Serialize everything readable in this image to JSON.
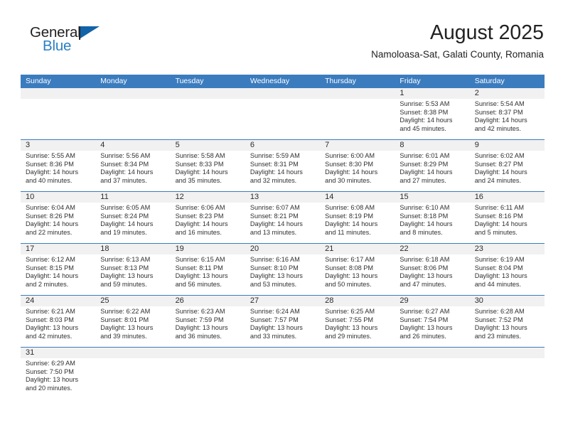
{
  "brand": {
    "name_top": "General",
    "name_bottom": "Blue",
    "flag_icon": "triangular-flag-icon",
    "color_top": "#231f20",
    "color_bottom": "#2b7fc4",
    "flag_color": "#1263a8"
  },
  "header": {
    "title": "August 2025",
    "subtitle": "Namoloasa-Sat, Galati County, Romania"
  },
  "colors": {
    "header_blue": "#3b7cbf",
    "numbar_gray": "#f1f1f1",
    "text": "#303030"
  },
  "weekdays": [
    "Sunday",
    "Monday",
    "Tuesday",
    "Wednesday",
    "Thursday",
    "Friday",
    "Saturday"
  ],
  "weeks": [
    [
      {
        "day": "",
        "lines": []
      },
      {
        "day": "",
        "lines": []
      },
      {
        "day": "",
        "lines": []
      },
      {
        "day": "",
        "lines": []
      },
      {
        "day": "",
        "lines": []
      },
      {
        "day": "1",
        "lines": [
          "Sunrise: 5:53 AM",
          "Sunset: 8:38 PM",
          "Daylight: 14 hours",
          "and 45 minutes."
        ]
      },
      {
        "day": "2",
        "lines": [
          "Sunrise: 5:54 AM",
          "Sunset: 8:37 PM",
          "Daylight: 14 hours",
          "and 42 minutes."
        ]
      }
    ],
    [
      {
        "day": "3",
        "lines": [
          "Sunrise: 5:55 AM",
          "Sunset: 8:36 PM",
          "Daylight: 14 hours",
          "and 40 minutes."
        ]
      },
      {
        "day": "4",
        "lines": [
          "Sunrise: 5:56 AM",
          "Sunset: 8:34 PM",
          "Daylight: 14 hours",
          "and 37 minutes."
        ]
      },
      {
        "day": "5",
        "lines": [
          "Sunrise: 5:58 AM",
          "Sunset: 8:33 PM",
          "Daylight: 14 hours",
          "and 35 minutes."
        ]
      },
      {
        "day": "6",
        "lines": [
          "Sunrise: 5:59 AM",
          "Sunset: 8:31 PM",
          "Daylight: 14 hours",
          "and 32 minutes."
        ]
      },
      {
        "day": "7",
        "lines": [
          "Sunrise: 6:00 AM",
          "Sunset: 8:30 PM",
          "Daylight: 14 hours",
          "and 30 minutes."
        ]
      },
      {
        "day": "8",
        "lines": [
          "Sunrise: 6:01 AM",
          "Sunset: 8:29 PM",
          "Daylight: 14 hours",
          "and 27 minutes."
        ]
      },
      {
        "day": "9",
        "lines": [
          "Sunrise: 6:02 AM",
          "Sunset: 8:27 PM",
          "Daylight: 14 hours",
          "and 24 minutes."
        ]
      }
    ],
    [
      {
        "day": "10",
        "lines": [
          "Sunrise: 6:04 AM",
          "Sunset: 8:26 PM",
          "Daylight: 14 hours",
          "and 22 minutes."
        ]
      },
      {
        "day": "11",
        "lines": [
          "Sunrise: 6:05 AM",
          "Sunset: 8:24 PM",
          "Daylight: 14 hours",
          "and 19 minutes."
        ]
      },
      {
        "day": "12",
        "lines": [
          "Sunrise: 6:06 AM",
          "Sunset: 8:23 PM",
          "Daylight: 14 hours",
          "and 16 minutes."
        ]
      },
      {
        "day": "13",
        "lines": [
          "Sunrise: 6:07 AM",
          "Sunset: 8:21 PM",
          "Daylight: 14 hours",
          "and 13 minutes."
        ]
      },
      {
        "day": "14",
        "lines": [
          "Sunrise: 6:08 AM",
          "Sunset: 8:19 PM",
          "Daylight: 14 hours",
          "and 11 minutes."
        ]
      },
      {
        "day": "15",
        "lines": [
          "Sunrise: 6:10 AM",
          "Sunset: 8:18 PM",
          "Daylight: 14 hours",
          "and 8 minutes."
        ]
      },
      {
        "day": "16",
        "lines": [
          "Sunrise: 6:11 AM",
          "Sunset: 8:16 PM",
          "Daylight: 14 hours",
          "and 5 minutes."
        ]
      }
    ],
    [
      {
        "day": "17",
        "lines": [
          "Sunrise: 6:12 AM",
          "Sunset: 8:15 PM",
          "Daylight: 14 hours",
          "and 2 minutes."
        ]
      },
      {
        "day": "18",
        "lines": [
          "Sunrise: 6:13 AM",
          "Sunset: 8:13 PM",
          "Daylight: 13 hours",
          "and 59 minutes."
        ]
      },
      {
        "day": "19",
        "lines": [
          "Sunrise: 6:15 AM",
          "Sunset: 8:11 PM",
          "Daylight: 13 hours",
          "and 56 minutes."
        ]
      },
      {
        "day": "20",
        "lines": [
          "Sunrise: 6:16 AM",
          "Sunset: 8:10 PM",
          "Daylight: 13 hours",
          "and 53 minutes."
        ]
      },
      {
        "day": "21",
        "lines": [
          "Sunrise: 6:17 AM",
          "Sunset: 8:08 PM",
          "Daylight: 13 hours",
          "and 50 minutes."
        ]
      },
      {
        "day": "22",
        "lines": [
          "Sunrise: 6:18 AM",
          "Sunset: 8:06 PM",
          "Daylight: 13 hours",
          "and 47 minutes."
        ]
      },
      {
        "day": "23",
        "lines": [
          "Sunrise: 6:19 AM",
          "Sunset: 8:04 PM",
          "Daylight: 13 hours",
          "and 44 minutes."
        ]
      }
    ],
    [
      {
        "day": "24",
        "lines": [
          "Sunrise: 6:21 AM",
          "Sunset: 8:03 PM",
          "Daylight: 13 hours",
          "and 42 minutes."
        ]
      },
      {
        "day": "25",
        "lines": [
          "Sunrise: 6:22 AM",
          "Sunset: 8:01 PM",
          "Daylight: 13 hours",
          "and 39 minutes."
        ]
      },
      {
        "day": "26",
        "lines": [
          "Sunrise: 6:23 AM",
          "Sunset: 7:59 PM",
          "Daylight: 13 hours",
          "and 36 minutes."
        ]
      },
      {
        "day": "27",
        "lines": [
          "Sunrise: 6:24 AM",
          "Sunset: 7:57 PM",
          "Daylight: 13 hours",
          "and 33 minutes."
        ]
      },
      {
        "day": "28",
        "lines": [
          "Sunrise: 6:25 AM",
          "Sunset: 7:55 PM",
          "Daylight: 13 hours",
          "and 29 minutes."
        ]
      },
      {
        "day": "29",
        "lines": [
          "Sunrise: 6:27 AM",
          "Sunset: 7:54 PM",
          "Daylight: 13 hours",
          "and 26 minutes."
        ]
      },
      {
        "day": "30",
        "lines": [
          "Sunrise: 6:28 AM",
          "Sunset: 7:52 PM",
          "Daylight: 13 hours",
          "and 23 minutes."
        ]
      }
    ],
    [
      {
        "day": "31",
        "lines": [
          "Sunrise: 6:29 AM",
          "Sunset: 7:50 PM",
          "Daylight: 13 hours",
          "and 20 minutes."
        ]
      },
      {
        "day": "",
        "lines": []
      },
      {
        "day": "",
        "lines": []
      },
      {
        "day": "",
        "lines": []
      },
      {
        "day": "",
        "lines": []
      },
      {
        "day": "",
        "lines": []
      },
      {
        "day": "",
        "lines": []
      }
    ]
  ]
}
